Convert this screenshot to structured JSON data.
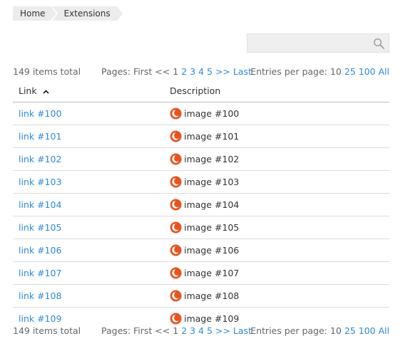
{
  "breadcrumb": {
    "home": "Home",
    "current": "Extensions"
  },
  "search": {
    "placeholder": "",
    "value": ""
  },
  "pager": {
    "total": "149 items total",
    "pages_label": "Pages:",
    "first": "First",
    "prev": "<<",
    "pages": [
      "1",
      "2",
      "3",
      "4",
      "5"
    ],
    "current_page": "1",
    "next": ">>",
    "last": "Last",
    "entries_label": "Entries per page:",
    "entries_options": [
      "10",
      "25",
      "100",
      "All"
    ],
    "current_entries": "10"
  },
  "table": {
    "columns": [
      "Link",
      "Description"
    ],
    "sort_column": "Link",
    "sort_direction": "ascending",
    "rows": [
      {
        "link": "link #100",
        "description": "image #100"
      },
      {
        "link": "link #101",
        "description": "image #101"
      },
      {
        "link": "link #102",
        "description": "image #102"
      },
      {
        "link": "link #103",
        "description": "image #103"
      },
      {
        "link": "link #104",
        "description": "image #104"
      },
      {
        "link": "link #105",
        "description": "image #105"
      },
      {
        "link": "link #106",
        "description": "image #106"
      },
      {
        "link": "link #107",
        "description": "image #107"
      },
      {
        "link": "link #108",
        "description": "image #108"
      },
      {
        "link": "link #109",
        "description": "image #109"
      }
    ]
  },
  "icons": {
    "search": "search-icon",
    "sort": "sort-ascending-icon",
    "row_image": "orange-orb-icon"
  },
  "colors": {
    "link": "#2e8ad6",
    "orb": "#e8531f",
    "breadcrumb_bg": "#ececec",
    "search_bg": "#efefef"
  }
}
